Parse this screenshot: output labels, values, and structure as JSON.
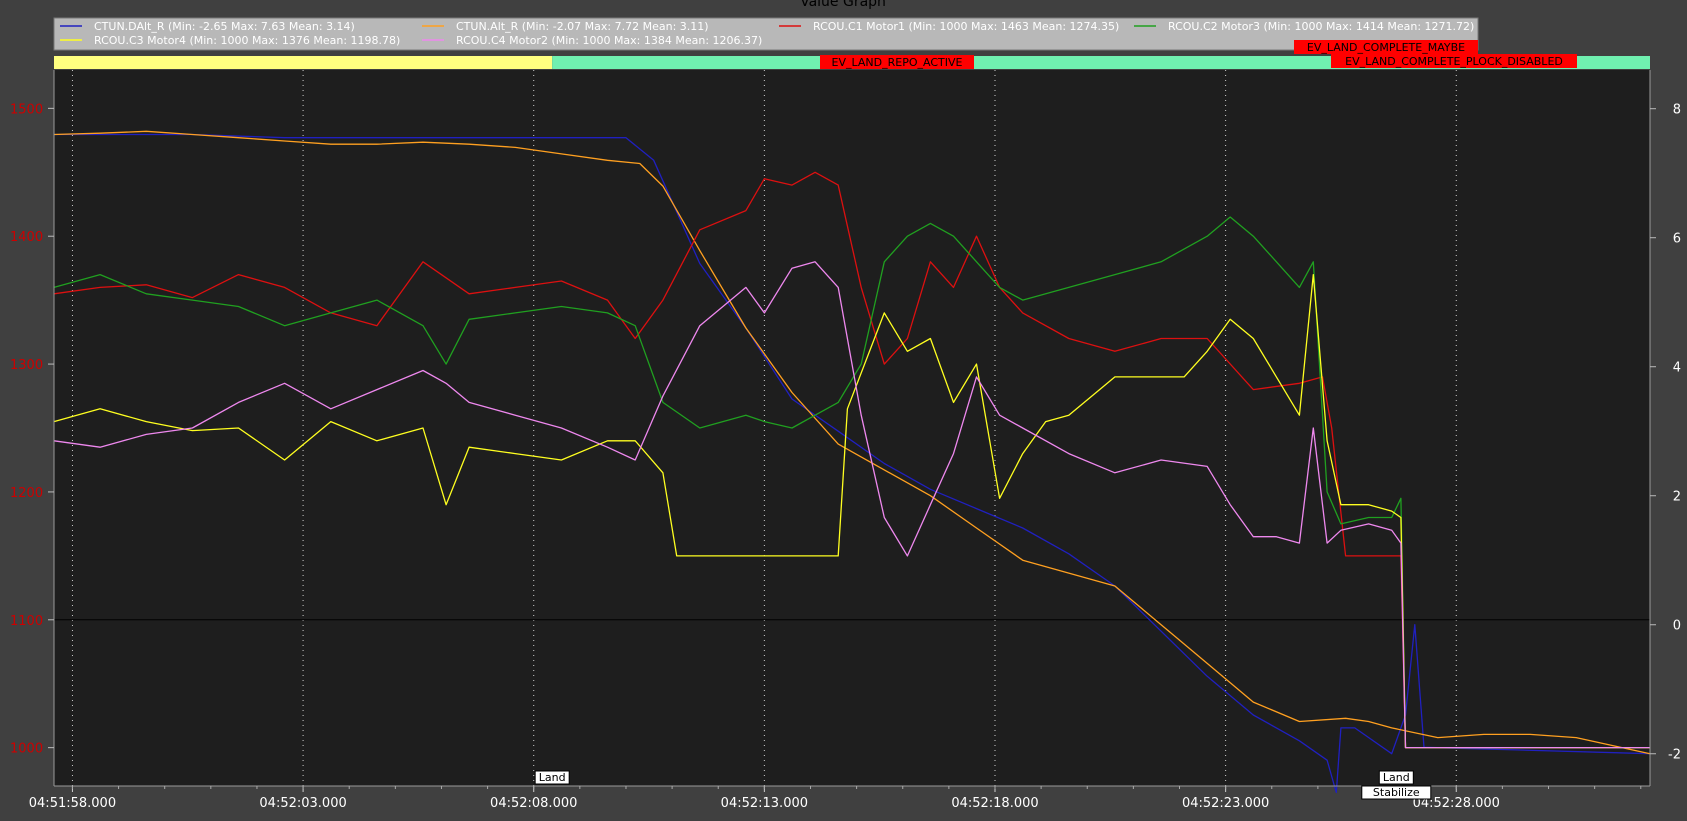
{
  "window": {
    "title": "Value Graph"
  },
  "legend": [
    {
      "label": "CTUN.DAlt_R (Min: -2.65 Max: 7.63 Mean: 3.14)",
      "color": "#2020c0"
    },
    {
      "label": "CTUN.Alt_R (Min: -2.07 Max: 7.72 Mean: 3.11)",
      "color": "#ffa020"
    },
    {
      "label": "RCOU.C1 Motor1 (Min: 1000 Max: 1463 Mean: 1274.35)",
      "color": "#dd1010"
    },
    {
      "label": "RCOU.C2 Motor3 (Min: 1000 Max: 1414 Mean: 1271.72)",
      "color": "#20a020"
    },
    {
      "label": "RCOU.C3 Motor4 (Min: 1000 Max: 1376 Mean: 1198.78)",
      "color": "#ffff20"
    },
    {
      "label": "RCOU.C4 Motor2 (Min: 1000 Max: 1384 Mean: 1206.37)",
      "color": "#ee88ee"
    }
  ],
  "events": [
    {
      "label": "EV_LAND_REPO_ACTIVE"
    },
    {
      "label": "EV_LAND_COMPLETE_MAYBE"
    },
    {
      "label": "EV_LAND_COMPLETE_PLOCK_DISABLED"
    }
  ],
  "modes": [
    {
      "label": "Land",
      "t": 10.8
    },
    {
      "label": "Land",
      "t": 29.1
    },
    {
      "label": "Stabilize",
      "t": 29.1
    }
  ],
  "state_bar": [
    {
      "from": 0,
      "to": 10.8,
      "color": "#ffff80"
    },
    {
      "from": 10.8,
      "to": 34.6,
      "color": "#70f0b0"
    }
  ],
  "chart_data": {
    "type": "line",
    "x_unit": "seconds after 04:51:57.6",
    "xlim": [
      0,
      34.6
    ],
    "x_ticks": [
      {
        "t": 0.4,
        "label": "04:51:58.000"
      },
      {
        "t": 5.4,
        "label": "04:52:03.000"
      },
      {
        "t": 10.4,
        "label": "04:52:08.000"
      },
      {
        "t": 15.4,
        "label": "04:52:13.000"
      },
      {
        "t": 20.4,
        "label": "04:52:18.000"
      },
      {
        "t": 25.4,
        "label": "04:52:23.000"
      },
      {
        "t": 30.4,
        "label": "04:52:28.000"
      }
    ],
    "y_left": {
      "lim": [
        970,
        1530
      ],
      "ticks": [
        1000,
        1100,
        1200,
        1300,
        1400,
        1500
      ]
    },
    "y_right": {
      "lim": [
        -2.5,
        8.6
      ],
      "ticks": [
        8,
        6,
        4,
        2,
        0,
        -2
      ]
    },
    "series": [
      {
        "name": "CTUN.DAlt_R",
        "axis": "right",
        "color": "#2020c0",
        "points": [
          [
            0,
            7.6
          ],
          [
            3,
            7.6
          ],
          [
            5,
            7.55
          ],
          [
            8,
            7.55
          ],
          [
            10,
            7.55
          ],
          [
            12.4,
            7.55
          ],
          [
            13,
            7.2
          ],
          [
            14,
            5.6
          ],
          [
            15,
            4.6
          ],
          [
            16,
            3.5
          ],
          [
            17,
            3.0
          ],
          [
            18,
            2.5
          ],
          [
            19,
            2.1
          ],
          [
            20,
            1.8
          ],
          [
            21,
            1.5
          ],
          [
            22,
            1.1
          ],
          [
            23,
            0.6
          ],
          [
            24,
            -0.1
          ],
          [
            25,
            -0.8
          ],
          [
            26,
            -1.4
          ],
          [
            27,
            -1.8
          ],
          [
            27.6,
            -2.1
          ],
          [
            27.8,
            -2.6
          ],
          [
            27.9,
            -1.6
          ],
          [
            28.2,
            -1.6
          ],
          [
            29,
            -2.0
          ],
          [
            29.3,
            -1.4
          ],
          [
            29.5,
            0.0
          ],
          [
            29.7,
            -1.9
          ],
          [
            34.6,
            -2.0
          ]
        ]
      },
      {
        "name": "CTUN.Alt_R",
        "axis": "right",
        "color": "#ffa020",
        "points": [
          [
            0,
            7.6
          ],
          [
            1,
            7.62
          ],
          [
            2,
            7.65
          ],
          [
            3,
            7.6
          ],
          [
            4,
            7.55
          ],
          [
            5,
            7.5
          ],
          [
            6,
            7.45
          ],
          [
            7,
            7.45
          ],
          [
            8,
            7.48
          ],
          [
            9,
            7.45
          ],
          [
            10,
            7.4
          ],
          [
            11,
            7.3
          ],
          [
            12,
            7.2
          ],
          [
            12.7,
            7.15
          ],
          [
            13.2,
            6.8
          ],
          [
            14,
            5.8
          ],
          [
            15,
            4.6
          ],
          [
            16,
            3.6
          ],
          [
            17,
            2.8
          ],
          [
            18,
            2.4
          ],
          [
            19,
            2.0
          ],
          [
            20,
            1.5
          ],
          [
            21,
            1.0
          ],
          [
            22,
            0.8
          ],
          [
            23,
            0.6
          ],
          [
            24,
            0.0
          ],
          [
            25,
            -0.6
          ],
          [
            26,
            -1.2
          ],
          [
            27,
            -1.5
          ],
          [
            28,
            -1.45
          ],
          [
            28.5,
            -1.5
          ],
          [
            29,
            -1.6
          ],
          [
            30,
            -1.75
          ],
          [
            31,
            -1.7
          ],
          [
            32,
            -1.7
          ],
          [
            33,
            -1.75
          ],
          [
            34.6,
            -2.0
          ]
        ]
      },
      {
        "name": "RCOU.C1 Motor1",
        "axis": "left",
        "color": "#dd1010",
        "points": [
          [
            0,
            1355
          ],
          [
            1,
            1360
          ],
          [
            2,
            1362
          ],
          [
            3,
            1352
          ],
          [
            4,
            1370
          ],
          [
            5,
            1360
          ],
          [
            6,
            1340
          ],
          [
            7,
            1330
          ],
          [
            8,
            1380
          ],
          [
            9,
            1355
          ],
          [
            10,
            1360
          ],
          [
            11,
            1365
          ],
          [
            12,
            1350
          ],
          [
            12.6,
            1320
          ],
          [
            13.2,
            1350
          ],
          [
            14,
            1405
          ],
          [
            15,
            1420
          ],
          [
            15.4,
            1445
          ],
          [
            16,
            1440
          ],
          [
            16.5,
            1450
          ],
          [
            17,
            1440
          ],
          [
            17.5,
            1360
          ],
          [
            18,
            1300
          ],
          [
            18.5,
            1320
          ],
          [
            19,
            1380
          ],
          [
            19.5,
            1360
          ],
          [
            20,
            1400
          ],
          [
            20.5,
            1360
          ],
          [
            21,
            1340
          ],
          [
            22,
            1320
          ],
          [
            23,
            1310
          ],
          [
            24,
            1320
          ],
          [
            25,
            1320
          ],
          [
            26,
            1280
          ],
          [
            27,
            1285
          ],
          [
            27.5,
            1290
          ],
          [
            27.7,
            1250
          ],
          [
            28.0,
            1150
          ],
          [
            28.3,
            1150
          ],
          [
            29,
            1150
          ],
          [
            29.2,
            1150
          ],
          [
            29.3,
            1000
          ],
          [
            34.6,
            1000
          ]
        ]
      },
      {
        "name": "RCOU.C2 Motor3",
        "axis": "left",
        "color": "#20a020",
        "points": [
          [
            0,
            1360
          ],
          [
            1,
            1370
          ],
          [
            2,
            1355
          ],
          [
            3,
            1350
          ],
          [
            4,
            1345
          ],
          [
            5,
            1330
          ],
          [
            6,
            1340
          ],
          [
            7,
            1350
          ],
          [
            8,
            1330
          ],
          [
            8.5,
            1300
          ],
          [
            9,
            1335
          ],
          [
            10,
            1340
          ],
          [
            11,
            1345
          ],
          [
            12,
            1340
          ],
          [
            12.6,
            1330
          ],
          [
            13.2,
            1270
          ],
          [
            14,
            1250
          ],
          [
            15,
            1260
          ],
          [
            15.4,
            1255
          ],
          [
            16,
            1250
          ],
          [
            16.5,
            1260
          ],
          [
            17,
            1270
          ],
          [
            17.5,
            1300
          ],
          [
            18,
            1380
          ],
          [
            18.5,
            1400
          ],
          [
            19,
            1410
          ],
          [
            19.5,
            1400
          ],
          [
            20,
            1380
          ],
          [
            20.5,
            1360
          ],
          [
            21,
            1350
          ],
          [
            22,
            1360
          ],
          [
            23,
            1370
          ],
          [
            24,
            1380
          ],
          [
            25,
            1400
          ],
          [
            25.5,
            1415
          ],
          [
            26,
            1400
          ],
          [
            26.5,
            1380
          ],
          [
            27,
            1360
          ],
          [
            27.3,
            1380
          ],
          [
            27.6,
            1200
          ],
          [
            27.9,
            1175
          ],
          [
            28.5,
            1180
          ],
          [
            29,
            1180
          ],
          [
            29.2,
            1195
          ],
          [
            29.3,
            1000
          ],
          [
            34.6,
            1000
          ]
        ]
      },
      {
        "name": "RCOU.C3 Motor4",
        "axis": "left",
        "color": "#ffff20",
        "points": [
          [
            0,
            1255
          ],
          [
            1,
            1265
          ],
          [
            2,
            1255
          ],
          [
            3,
            1248
          ],
          [
            4,
            1250
          ],
          [
            5,
            1225
          ],
          [
            6,
            1255
          ],
          [
            7,
            1240
          ],
          [
            8,
            1250
          ],
          [
            8.5,
            1190
          ],
          [
            9,
            1235
          ],
          [
            10,
            1230
          ],
          [
            11,
            1225
          ],
          [
            12,
            1240
          ],
          [
            12.6,
            1240
          ],
          [
            13.2,
            1215
          ],
          [
            13.5,
            1150
          ],
          [
            16.5,
            1150
          ],
          [
            17.0,
            1150
          ],
          [
            17.2,
            1265
          ],
          [
            18,
            1340
          ],
          [
            18.5,
            1310
          ],
          [
            19,
            1320
          ],
          [
            19.5,
            1270
          ],
          [
            20,
            1300
          ],
          [
            20.5,
            1195
          ],
          [
            21,
            1230
          ],
          [
            21.5,
            1255
          ],
          [
            22,
            1260
          ],
          [
            23,
            1290
          ],
          [
            24,
            1290
          ],
          [
            24.5,
            1290
          ],
          [
            25,
            1310
          ],
          [
            25.5,
            1335
          ],
          [
            26,
            1320
          ],
          [
            26.5,
            1290
          ],
          [
            27,
            1260
          ],
          [
            27.3,
            1370
          ],
          [
            27.6,
            1240
          ],
          [
            27.9,
            1190
          ],
          [
            28.5,
            1190
          ],
          [
            29,
            1185
          ],
          [
            29.2,
            1180
          ],
          [
            29.3,
            1000
          ],
          [
            34.6,
            1000
          ]
        ]
      },
      {
        "name": "RCOU.C4 Motor2",
        "axis": "left",
        "color": "#ee88ee",
        "points": [
          [
            0,
            1240
          ],
          [
            1,
            1235
          ],
          [
            2,
            1245
          ],
          [
            3,
            1250
          ],
          [
            4,
            1270
          ],
          [
            5,
            1285
          ],
          [
            6,
            1265
          ],
          [
            7,
            1280
          ],
          [
            8,
            1295
          ],
          [
            8.5,
            1285
          ],
          [
            9,
            1270
          ],
          [
            10,
            1260
          ],
          [
            11,
            1250
          ],
          [
            12,
            1235
          ],
          [
            12.6,
            1225
          ],
          [
            13.2,
            1275
          ],
          [
            14,
            1330
          ],
          [
            15,
            1360
          ],
          [
            15.4,
            1340
          ],
          [
            16,
            1375
          ],
          [
            16.5,
            1380
          ],
          [
            17,
            1360
          ],
          [
            17.5,
            1260
          ],
          [
            18,
            1180
          ],
          [
            18.5,
            1150
          ],
          [
            19,
            1190
          ],
          [
            19.5,
            1230
          ],
          [
            20,
            1290
          ],
          [
            20.5,
            1260
          ],
          [
            21,
            1250
          ],
          [
            22,
            1230
          ],
          [
            23,
            1215
          ],
          [
            24,
            1225
          ],
          [
            25,
            1220
          ],
          [
            25.5,
            1190
          ],
          [
            26,
            1165
          ],
          [
            26.5,
            1165
          ],
          [
            27,
            1160
          ],
          [
            27.3,
            1250
          ],
          [
            27.6,
            1160
          ],
          [
            27.9,
            1170
          ],
          [
            28.5,
            1175
          ],
          [
            29,
            1170
          ],
          [
            29.2,
            1160
          ],
          [
            29.3,
            1000
          ],
          [
            34.6,
            1000
          ]
        ]
      }
    ]
  }
}
